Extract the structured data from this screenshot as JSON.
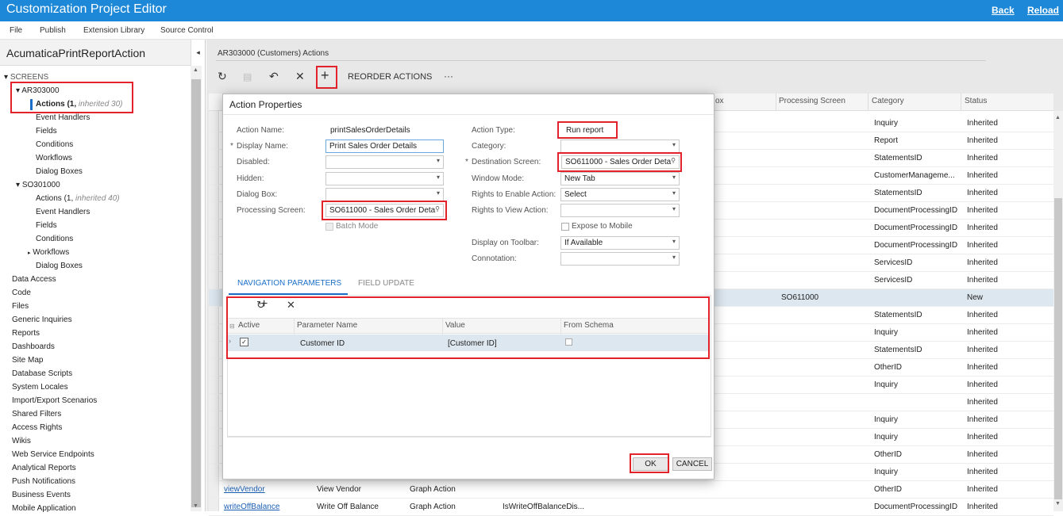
{
  "app": {
    "title": "Customization Project Editor",
    "back": "Back",
    "reload": "Reload"
  },
  "menu": [
    "File",
    "Publish",
    "Extension Library",
    "Source Control"
  ],
  "project": {
    "name": "AcumaticaPrintReportAction",
    "collapse": "◂"
  },
  "tree": {
    "screens": "SCREENS",
    "ar": {
      "code": "AR303000",
      "actions": "Actions",
      "actions_count": "(1,",
      "actions_inh": "inherited 30)",
      "items": [
        "Event Handlers",
        "Fields",
        "Conditions",
        "Workflows",
        "Dialog Boxes"
      ]
    },
    "so": {
      "code": "SO301000",
      "actions": "Actions (1,",
      "actions_inh": "inherited 40)",
      "items": [
        "Event Handlers",
        "Fields",
        "Conditions",
        "Workflows",
        "Dialog Boxes"
      ]
    },
    "nodes": [
      "Data Access",
      "Code",
      "Files",
      "Generic Inquiries",
      "Reports",
      "Dashboards",
      "Site Map",
      "Database Scripts",
      "System Locales",
      "Import/Export Scenarios",
      "Shared Filters",
      "Access Rights",
      "Wikis",
      "Web Service Endpoints",
      "Analytical Reports",
      "Push Notifications",
      "Business Events",
      "Mobile Application"
    ]
  },
  "main": {
    "crumb": "AR303000 (Customers) Actions",
    "reorder": "REORDER ACTIONS",
    "more": "···"
  },
  "grid": {
    "headers": [
      "ox",
      "Processing Screen",
      "Category",
      "Status"
    ],
    "rows": [
      {
        "cat": "Inquiry",
        "status": "Inherited"
      },
      {
        "cat": "Report",
        "status": "Inherited"
      },
      {
        "cat": "StatementsID",
        "status": "Inherited"
      },
      {
        "cat": "CustomerManageme...",
        "status": "Inherited"
      },
      {
        "cat": "StatementsID",
        "status": "Inherited"
      },
      {
        "cat": "DocumentProcessingID",
        "status": "Inherited"
      },
      {
        "cat": "DocumentProcessingID",
        "status": "Inherited"
      },
      {
        "cat": "DocumentProcessingID",
        "status": "Inherited"
      },
      {
        "cat": "ServicesID",
        "status": "Inherited"
      },
      {
        "cat": "ServicesID",
        "status": "Inherited"
      },
      {
        "proc": "SO611000",
        "cat": "",
        "status": "New"
      },
      {
        "cat": "StatementsID",
        "status": "Inherited"
      },
      {
        "cat": "Inquiry",
        "status": "Inherited"
      },
      {
        "cat": "StatementsID",
        "status": "Inherited"
      },
      {
        "cat": "OtherID",
        "status": "Inherited"
      },
      {
        "cat": "Inquiry",
        "status": "Inherited"
      },
      {
        "cat": "",
        "status": "Inherited"
      },
      {
        "cat": "Inquiry",
        "status": "Inherited"
      },
      {
        "cat": "Inquiry",
        "status": "Inherited"
      },
      {
        "cat": "OtherID",
        "status": "Inherited"
      },
      {
        "cat": "Inquiry",
        "status": "Inherited"
      },
      {
        "name": "viewVendor",
        "display": "View Vendor",
        "type": "Graph Action",
        "cat": "OtherID",
        "status": "Inherited"
      },
      {
        "name": "writeOffBalance",
        "display": "Write Off Balance",
        "type": "Graph Action",
        "extra": "IsWriteOffBalanceDis...",
        "cat": "DocumentProcessingID",
        "status": "Inherited"
      }
    ]
  },
  "dialog": {
    "title": "Action Properties",
    "left": {
      "action_name_label": "Action Name:",
      "action_name": "printSalesOrderDetails",
      "display_name_label": "Display Name:",
      "display_name": "Print Sales Order Details",
      "disabled_label": "Disabled:",
      "hidden_label": "Hidden:",
      "dialog_box_label": "Dialog Box:",
      "processing_label": "Processing Screen:",
      "processing": "SO611000 - Sales Order Deta",
      "batch_mode": "Batch Mode"
    },
    "right": {
      "action_type_label": "Action Type:",
      "action_type": "Run report",
      "category_label": "Category:",
      "destination_label": "Destination Screen:",
      "destination": "SO611000 - Sales Order Deta",
      "window_mode_label": "Window Mode:",
      "window_mode": "New Tab",
      "rights_enable_label": "Rights to Enable Action:",
      "rights_enable": "Select",
      "rights_view_label": "Rights to View Action:",
      "expose_mobile": "Expose to Mobile",
      "toolbar_label": "Display on Toolbar:",
      "toolbar": "If Available",
      "connotation_label": "Connotation:"
    },
    "tabs": [
      "NAVIGATION PARAMETERS",
      "FIELD UPDATE"
    ],
    "params": {
      "headers": [
        "Active",
        "Parameter Name",
        "Value",
        "From Schema"
      ],
      "rows": [
        {
          "name": "Customer ID",
          "value": "[Customer ID]"
        }
      ]
    },
    "ok": "OK",
    "cancel": "CANCEL"
  }
}
